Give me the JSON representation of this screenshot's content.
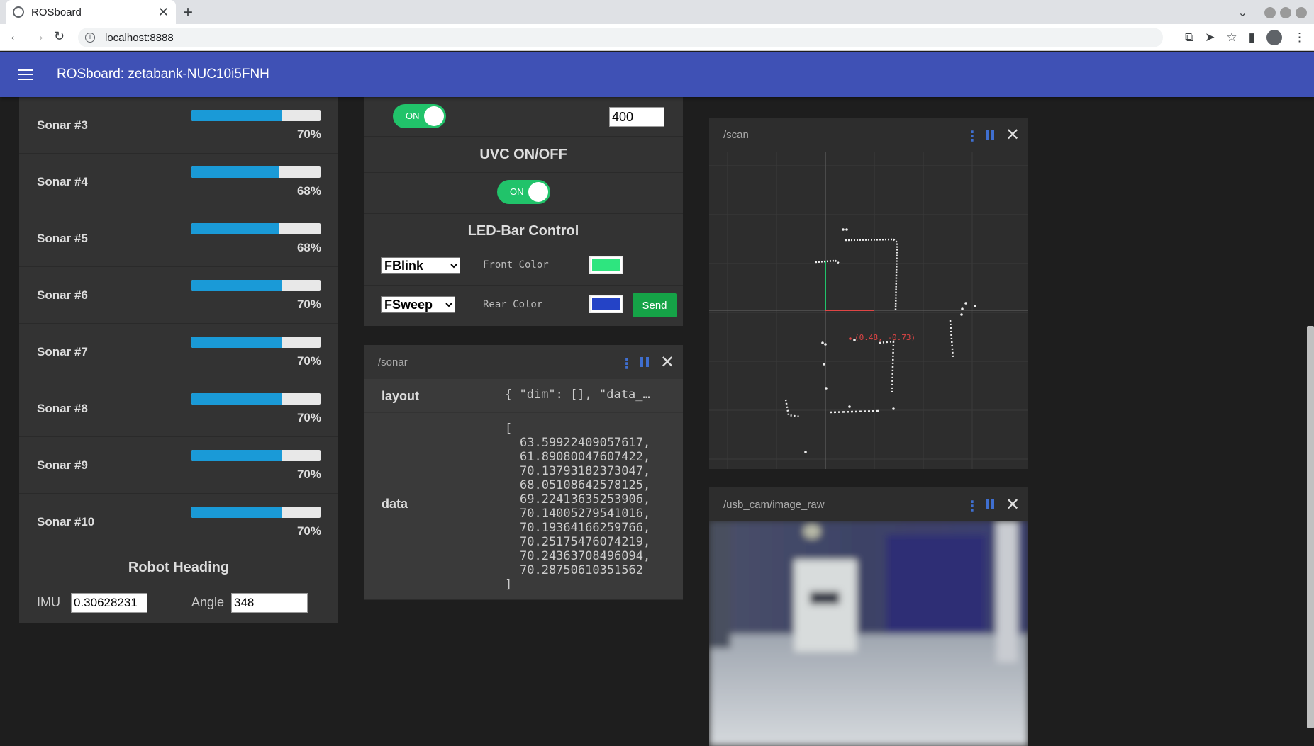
{
  "browser": {
    "tab_title": "ROSboard",
    "url": "localhost:8888"
  },
  "app": {
    "title": "ROSboard: zetabank-NUC10i5FNH"
  },
  "sonars": [
    {
      "label": "Sonar #3",
      "value": 70,
      "text": "70%"
    },
    {
      "label": "Sonar #4",
      "value": 68,
      "text": "68%"
    },
    {
      "label": "Sonar #5",
      "value": 68,
      "text": "68%"
    },
    {
      "label": "Sonar #6",
      "value": 70,
      "text": "70%"
    },
    {
      "label": "Sonar #7",
      "value": 70,
      "text": "70%"
    },
    {
      "label": "Sonar #8",
      "value": 70,
      "text": "70%"
    },
    {
      "label": "Sonar #9",
      "value": 70,
      "text": "70%"
    },
    {
      "label": "Sonar #10",
      "value": 70,
      "text": "70%"
    }
  ],
  "heading": {
    "title": "Robot Heading",
    "imu_label": "IMU",
    "imu_value": "0.30628231",
    "angle_label": "Angle",
    "angle_value": "348"
  },
  "control": {
    "toggle1_label": "ON",
    "top_value": "400",
    "uvc_title": "UVC ON/OFF",
    "uvc_toggle_label": "ON",
    "led_title": "LED-Bar Control",
    "front_mode": "FBlink",
    "front_label": "Front Color",
    "front_color": "#2ee57f",
    "rear_mode": "FSweep",
    "rear_label": "Rear Color",
    "rear_color": "#2443c6",
    "send_label": "Send"
  },
  "sonar_panel": {
    "title": "/sonar",
    "layout_key": "layout",
    "layout_value": "{ \"dim\": [], \"data_…",
    "data_key": "data",
    "data_open": "[",
    "data_values": [
      "63.59922409057617,",
      "61.89080047607422,",
      "70.13793182373047,",
      "68.05108642578125,",
      "69.22413635253906,",
      "70.14005279541016,",
      "70.19364166259766,",
      "70.25175476074219,",
      "70.24363708496094,",
      "70.28750610351562"
    ],
    "data_close": "]"
  },
  "scan_panel": {
    "title": "/scan",
    "cursor_label": "(0.48, -0.73)"
  },
  "usb_panel": {
    "title": "/usb_cam/image_raw"
  }
}
